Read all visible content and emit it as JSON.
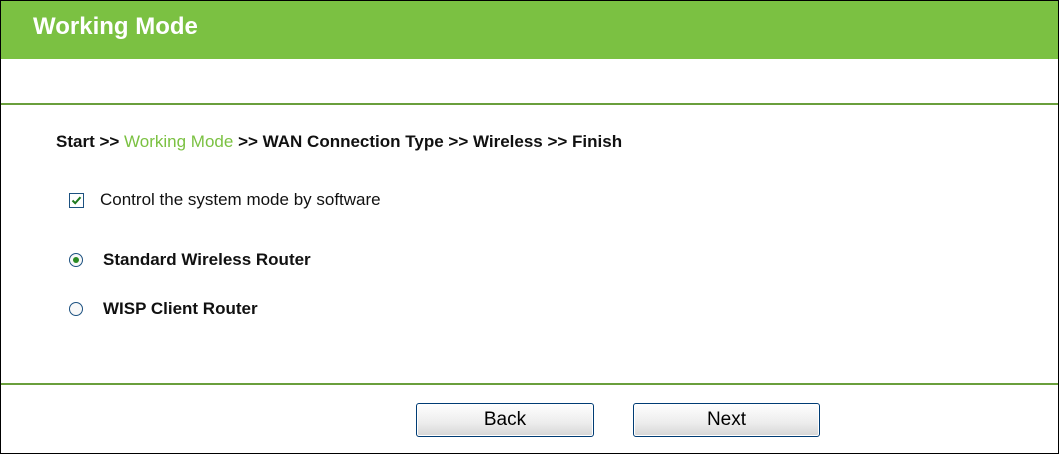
{
  "header": {
    "title": "Working Mode"
  },
  "breadcrumb": {
    "step1": "Start >>",
    "current": "Working Mode",
    "rest": ">> WAN Connection Type >> Wireless >> Finish"
  },
  "options": {
    "checkbox_label": "Control the system mode by software",
    "checkbox_checked": true,
    "radio1_label": "Standard Wireless Router",
    "radio1_selected": true,
    "radio2_label": "WISP Client Router",
    "radio2_selected": false
  },
  "buttons": {
    "back": "Back",
    "next": "Next"
  },
  "colors": {
    "header_bg": "#7bc142",
    "accent": "#7bc142",
    "divider": "#6a9f3c"
  }
}
